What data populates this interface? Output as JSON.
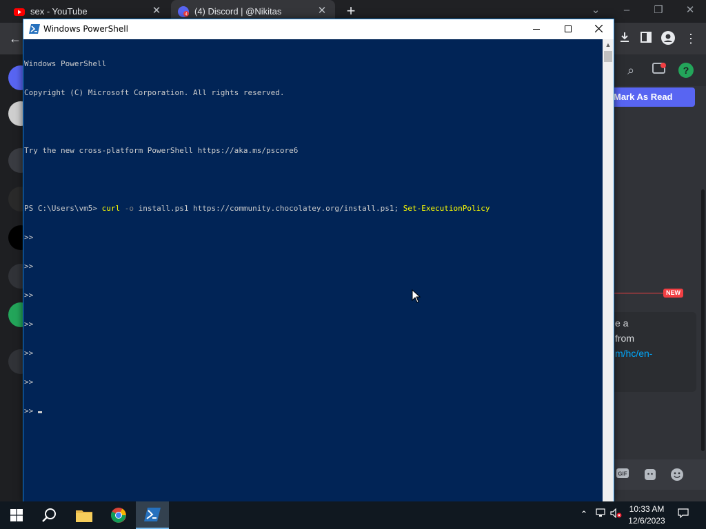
{
  "browser": {
    "tabs": [
      {
        "title": "sex - YouTube"
      },
      {
        "title": "(4) Discord | @Nikitas",
        "badge": "4"
      }
    ],
    "new_tab_symbol": "+",
    "window_controls": [
      "chevron-down-icon",
      "minimize-icon",
      "restore-icon",
      "close-icon"
    ]
  },
  "discord": {
    "mark_as_read": "Mark As Read",
    "new_badge": "NEW",
    "message_lines": [
      "e a",
      "from",
      "m/hc/en-"
    ],
    "composer_icons": [
      "gif-icon",
      "sticker-icon",
      "emoji-icon"
    ],
    "colors": {
      "blurple": "#5865f2",
      "red": "#f23f43",
      "link": "#00a8fc"
    }
  },
  "powershell": {
    "title": "Windows PowerShell",
    "colors": {
      "background": "#012456",
      "text": "#cccccc",
      "command": "#ffff00",
      "parameter": "#808080"
    },
    "lines": {
      "l1": "Windows PowerShell",
      "l2": "Copyright (C) Microsoft Corporation. All rights reserved.",
      "l3": "",
      "l4": "Try the new cross-platform PowerShell https://aka.ms/pscore6",
      "l5": ""
    },
    "command": {
      "prompt": "PS C:\\Users\\vm5> ",
      "cmd": "curl",
      "param": " -o",
      "args": " install.ps1 https://community.chocolatey.org/install.ps1; ",
      "cmd2": "Set-ExecutionPolicy"
    },
    "continuation": [
      ">>",
      ">>",
      ">>",
      ">>",
      ">>",
      ">>",
      ">>"
    ]
  },
  "taskbar": {
    "time": "10:33 AM",
    "date": "12/6/2023",
    "pinned": [
      "windows-start-icon",
      "search-icon",
      "file-explorer-icon",
      "chrome-icon",
      "powershell-icon"
    ]
  }
}
